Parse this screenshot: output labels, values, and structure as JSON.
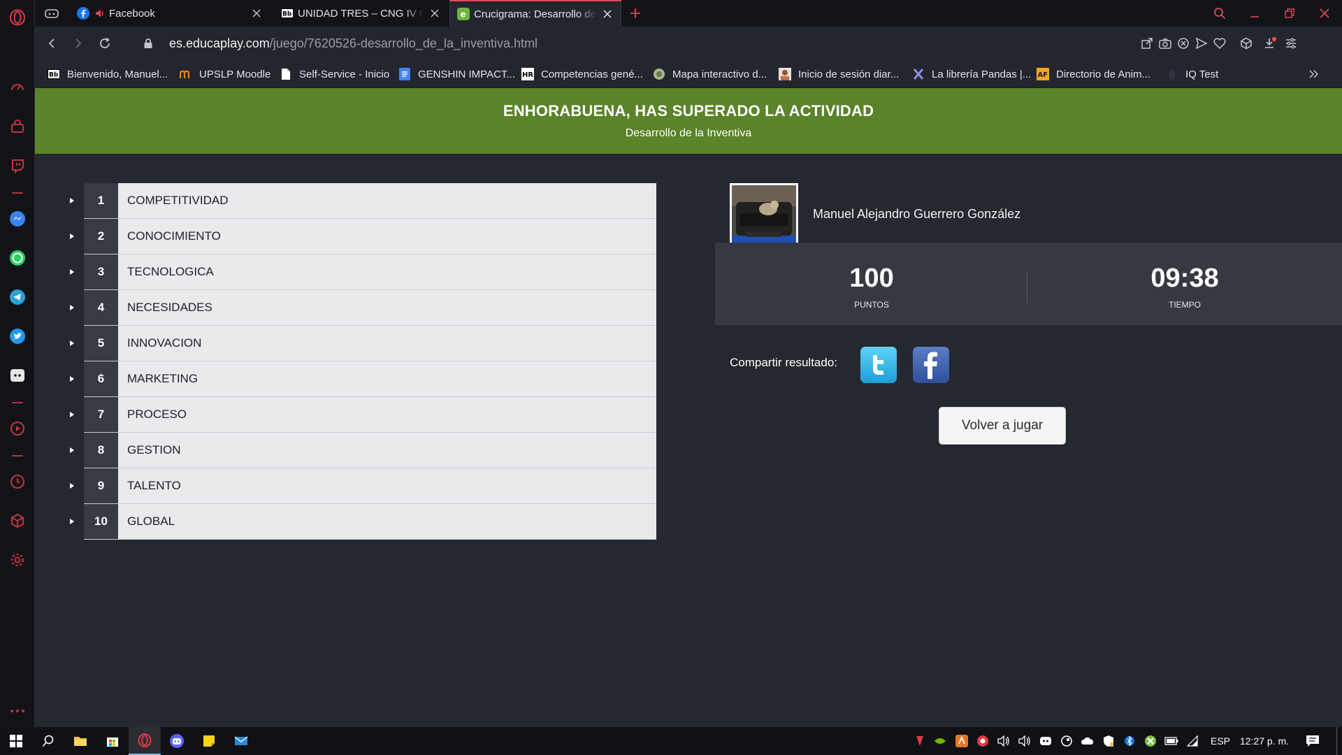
{
  "browser": {
    "tabs": [
      {
        "title": "Facebook",
        "favicon": "facebook-icon",
        "audio": true
      },
      {
        "title": "UNIDAD TRES – CNG IV Cre",
        "favicon": "blackboard-icon"
      },
      {
        "title": "Crucigrama: Desarrollo de l",
        "favicon": "educaplay-icon",
        "active": true
      }
    ],
    "url_domain": "es.educaplay.com",
    "url_path": "/juego/7620526-desarrollo_de_la_inventiva.html",
    "bookmarks": [
      {
        "label": "Bienvenido, Manuel...",
        "icon": "blackboard-icon"
      },
      {
        "label": "UPSLP Moodle",
        "icon": "moodle-icon"
      },
      {
        "label": "Self-Service - Inicio",
        "icon": "document-icon"
      },
      {
        "label": "GENSHIN IMPACT...",
        "icon": "docs-icon"
      },
      {
        "label": "Competencias gené...",
        "icon": "hr-icon"
      },
      {
        "label": "Mapa interactivo d...",
        "icon": "map-icon"
      },
      {
        "label": "Inicio de sesión diar...",
        "icon": "avatar-icon"
      },
      {
        "label": "La librería Pandas |...",
        "icon": "x-logo-icon"
      },
      {
        "label": "Directorio de Anim...",
        "icon": "af-icon"
      },
      {
        "label": "IQ Test",
        "icon": "drop-icon"
      }
    ],
    "accent": "#e04b57"
  },
  "banner": {
    "title": "ENHORABUENA, HAS SUPERADO LA ACTIVIDAD",
    "subtitle": "Desarrollo de la Inventiva",
    "color": "#5a832a"
  },
  "words": [
    {
      "n": "1",
      "w": "COMPETITIVIDAD"
    },
    {
      "n": "2",
      "w": "CONOCIMIENTO"
    },
    {
      "n": "3",
      "w": "TECNOLOGICA"
    },
    {
      "n": "4",
      "w": "NECESIDADES"
    },
    {
      "n": "5",
      "w": "INNOVACION"
    },
    {
      "n": "6",
      "w": "MARKETING"
    },
    {
      "n": "7",
      "w": "PROCESO"
    },
    {
      "n": "8",
      "w": "GESTION"
    },
    {
      "n": "9",
      "w": "TALENTO"
    },
    {
      "n": "10",
      "w": "GLOBAL"
    }
  ],
  "user": {
    "name": "Manuel Alejandro Guerrero González"
  },
  "stats": {
    "points_value": "100",
    "points_label": "PUNTOS",
    "time_value": "09:38",
    "time_label": "TIEMPO"
  },
  "share": {
    "label": "Compartir resultado:"
  },
  "replay_label": "Volver a jugar",
  "taskbar": {
    "language": "ESP",
    "clock": "12:27 p. m."
  }
}
